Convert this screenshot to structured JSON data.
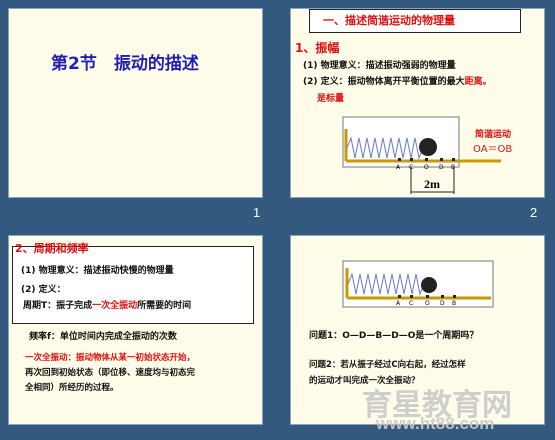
{
  "slide1": {
    "title": "第2节　振动的描述",
    "number": "1"
  },
  "slide2": {
    "heading": "一、描述简谐运动的物理量",
    "section": "1、振幅",
    "line1": "(1) 物理意义：描述振动强弱的物理量",
    "line2": "(2) 定义：振动物体离开平衡位置的最大距离。",
    "line3": "是标量",
    "label_motion": "简谐运动",
    "label_eq": "OA＝OB",
    "marks": [
      "A",
      "C",
      "O",
      "D",
      "B"
    ],
    "dim_label": "2m",
    "number": "2"
  },
  "slide3": {
    "section": "2、周期和频率",
    "line1": "(1) 物理意义：描述振动快慢的物理量",
    "line2": "(2) 定义：",
    "line3": "周期T：振子完成一次全振动所需要的时间",
    "line4": "频率f：单位时间内完成全振动的次数",
    "line5": "一次全振动：振动物体从某一初始状态开始，",
    "line6": "再次回到初始状态（即位移、速度均与初态完",
    "line7": "全相同）所经历的过程。"
  },
  "slide4": {
    "marks": [
      "A",
      "C",
      "O",
      "D",
      "B"
    ],
    "q1": "问题1：O—D—B—D—O是一个周期吗？",
    "q2a": "问题2：若从振子经过C向右起，经过怎样",
    "q2b": "的运动才叫完成一次全振动？"
  },
  "watermark": {
    "main": "育星教育网",
    "url": "www.ht88.com"
  },
  "colors": {
    "background": "#33597e",
    "slide": "#fffde9",
    "red": "#e01010",
    "blue": "#1f1fb8"
  }
}
